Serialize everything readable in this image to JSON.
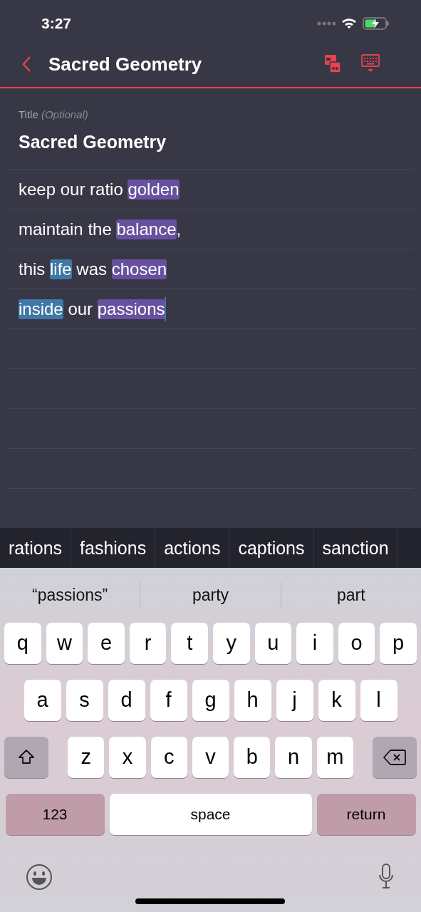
{
  "status_bar": {
    "time": "3:27"
  },
  "nav": {
    "title": "Sacred Geometry"
  },
  "title_field": {
    "label": "Title",
    "hint": "(Optional)",
    "value": "Sacred Geometry"
  },
  "lyrics": [
    {
      "segments": [
        {
          "kind": "plain",
          "text": "keep our ratio "
        },
        {
          "kind": "rhyme",
          "text": "golden",
          "color": "#67519f"
        }
      ]
    },
    {
      "segments": [
        {
          "kind": "plain",
          "text": "maintain the "
        },
        {
          "kind": "rhyme",
          "text": "balance",
          "color": "#67519f"
        },
        {
          "kind": "plain",
          "text": ","
        }
      ]
    },
    {
      "segments": [
        {
          "kind": "plain",
          "text": "this "
        },
        {
          "kind": "rhyme",
          "text": "life",
          "color": "#3f78a6"
        },
        {
          "kind": "plain",
          "text": " was "
        },
        {
          "kind": "rhyme",
          "text": "chosen",
          "color": "#67519f"
        }
      ]
    },
    {
      "segments": [
        {
          "kind": "rhyme",
          "text": "inside",
          "color": "#3f78a6"
        },
        {
          "kind": "plain",
          "text": " our "
        },
        {
          "kind": "rhyme",
          "text": "passions",
          "color": "#67519f"
        }
      ],
      "cursor": true
    }
  ],
  "rhyme_suggestions": [
    "rations",
    "fashions",
    "actions",
    "captions",
    "sanction"
  ],
  "predictions": [
    "“passions”",
    "party",
    "part"
  ],
  "keyboard": [
    [
      {
        "kind": "letter",
        "label": "q"
      },
      {
        "kind": "letter",
        "label": "w"
      },
      {
        "kind": "letter",
        "label": "e"
      },
      {
        "kind": "letter",
        "label": "r"
      },
      {
        "kind": "letter",
        "label": "t"
      },
      {
        "kind": "letter",
        "label": "y"
      },
      {
        "kind": "letter",
        "label": "u"
      },
      {
        "kind": "letter",
        "label": "i"
      },
      {
        "kind": "letter",
        "label": "o"
      },
      {
        "kind": "letter",
        "label": "p"
      }
    ],
    [
      {
        "kind": "letter",
        "label": "a"
      },
      {
        "kind": "letter",
        "label": "s"
      },
      {
        "kind": "letter",
        "label": "d"
      },
      {
        "kind": "letter",
        "label": "f"
      },
      {
        "kind": "letter",
        "label": "g"
      },
      {
        "kind": "letter",
        "label": "h"
      },
      {
        "kind": "letter",
        "label": "j"
      },
      {
        "kind": "letter",
        "label": "k"
      },
      {
        "kind": "letter",
        "label": "l"
      }
    ],
    [
      {
        "kind": "shift"
      },
      {
        "kind": "letter",
        "label": "z"
      },
      {
        "kind": "letter",
        "label": "x"
      },
      {
        "kind": "letter",
        "label": "c"
      },
      {
        "kind": "letter",
        "label": "v"
      },
      {
        "kind": "letter",
        "label": "b"
      },
      {
        "kind": "letter",
        "label": "n"
      },
      {
        "kind": "letter",
        "label": "m"
      },
      {
        "kind": "delete"
      }
    ],
    [
      {
        "kind": "mode",
        "label": "123"
      },
      {
        "kind": "space",
        "label": "space"
      },
      {
        "kind": "return",
        "label": "return"
      }
    ]
  ]
}
